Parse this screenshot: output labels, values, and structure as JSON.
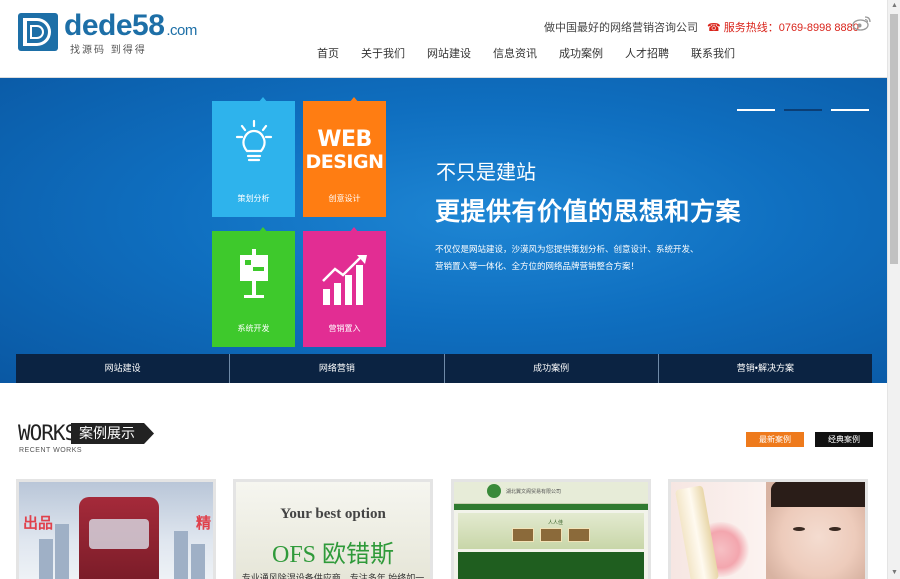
{
  "header": {
    "logo_text": "dede58",
    "logo_domain": ".com",
    "logo_slogan": "找源码 到得得",
    "tagline": "做中国最好的网络营销咨询公司",
    "hotline_icon": "phone-icon",
    "hotline": "服务热线：0769-8998 8880",
    "weibo_icon": "weibo-icon",
    "brand_color": "#1d6fa7",
    "hotline_color": "#d9241b"
  },
  "nav": {
    "items": [
      {
        "label": "首页"
      },
      {
        "label": "关于我们"
      },
      {
        "label": "网站建设"
      },
      {
        "label": "信息资讯"
      },
      {
        "label": "成功案例"
      },
      {
        "label": "人才招聘"
      },
      {
        "label": "联系我们"
      }
    ]
  },
  "banner": {
    "tiles": [
      {
        "label": "策划分析",
        "icon": "lightbulb-icon",
        "color": "#2eb3ec"
      },
      {
        "label": "创意设计",
        "icon": "web-design-icon",
        "color": "#ff7d12",
        "art_text_1": "WEB",
        "art_text_2": "DESIGN"
      },
      {
        "label": "系统开发",
        "icon": "easel-icon",
        "color": "#3ec92c"
      },
      {
        "label": "营销置入",
        "icon": "chart-icon",
        "color": "#e22d93"
      }
    ],
    "subtitle": "不只是建站",
    "title": "更提供有价值的思想和方案",
    "description": "不仅仅是网站建设，沙漠风为您提供策划分析、创意设计、系统开发、营销置入等一体化、全方位的网络品牌营销整合方案！",
    "slide_count": 3,
    "active_slide": 2,
    "tabs": [
      {
        "label": "网站建设"
      },
      {
        "label": "网络营销"
      },
      {
        "label": "成功案例"
      },
      {
        "label": "营销•解决方案"
      }
    ]
  },
  "works": {
    "title_en": "WORKS",
    "title_cn": "案例展示",
    "subtitle": "RECENT WORKS",
    "latest_label": "最新案例",
    "classic_label": "经典案例",
    "cases": [
      {
        "text_left": "出品",
        "text_right": "精"
      },
      {
        "title": "Your best option",
        "brand": "OFS 欧错斯",
        "line": "专业通风除湿设备供应商，专注多年,始终如一"
      },
      {
        "company": "湖北翼文阁贸易有限公司",
        "banner_text": "人人佳"
      },
      {}
    ]
  }
}
